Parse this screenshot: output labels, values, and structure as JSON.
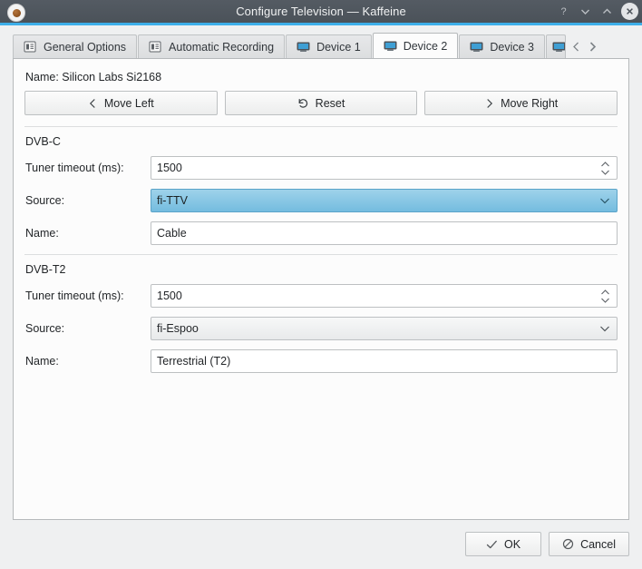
{
  "window": {
    "title": "Configure Television — Kaffeine",
    "app_icon": "kaffeine-coffee-cup-icon",
    "controls": {
      "help": "?",
      "minimize": "minimize-icon",
      "maximize": "maximize-icon",
      "close": "close-icon"
    }
  },
  "tabs": [
    {
      "label": "General Options",
      "icon": "form-document-icon",
      "active": false
    },
    {
      "label": "Automatic Recording",
      "icon": "form-document-icon",
      "active": false
    },
    {
      "label": "Device 1",
      "icon": "television-icon",
      "active": false
    },
    {
      "label": "Device 2",
      "icon": "television-icon",
      "active": true
    },
    {
      "label": "Device 3",
      "icon": "television-icon",
      "active": false
    },
    {
      "label": "",
      "icon": "television-icon",
      "active": false,
      "clipped": true
    }
  ],
  "tab_scroll": {
    "left": "chevron-left-icon",
    "right": "chevron-right-icon"
  },
  "panel": {
    "device_name": "Name: Silicon Labs Si2168",
    "move_buttons": [
      {
        "label": "Move Left",
        "icon": "chevron-left-icon"
      },
      {
        "label": "Reset",
        "icon": "undo-icon"
      },
      {
        "label": "Move Right",
        "icon": "chevron-right-icon"
      }
    ],
    "groups": [
      {
        "title": "DVB-C",
        "fields": [
          {
            "label": "Tuner timeout (ms):",
            "type": "spinbox",
            "value": "1500"
          },
          {
            "label": "Source:",
            "type": "combobox",
            "value": "fi-TTV",
            "selected": true
          },
          {
            "label": "Name:",
            "type": "text",
            "value": "Cable"
          }
        ]
      },
      {
        "title": "DVB-T2",
        "fields": [
          {
            "label": "Tuner timeout (ms):",
            "type": "spinbox",
            "value": "1500"
          },
          {
            "label": "Source:",
            "type": "combobox",
            "value": "fi-Espoo",
            "selected": false
          },
          {
            "label": "Name:",
            "type": "text",
            "value": "Terrestrial (T2)"
          }
        ]
      }
    ]
  },
  "dialog_buttons": [
    {
      "label": "OK",
      "icon": "check-icon"
    },
    {
      "label": "Cancel",
      "icon": "cancel-circle-icon"
    }
  ],
  "colors": {
    "titlebar": "#4e555d",
    "accent": "#3daee9",
    "window_bg": "#eff0f1",
    "panel_bg": "#fcfcfc",
    "selection_blue": "#74bcdf"
  }
}
